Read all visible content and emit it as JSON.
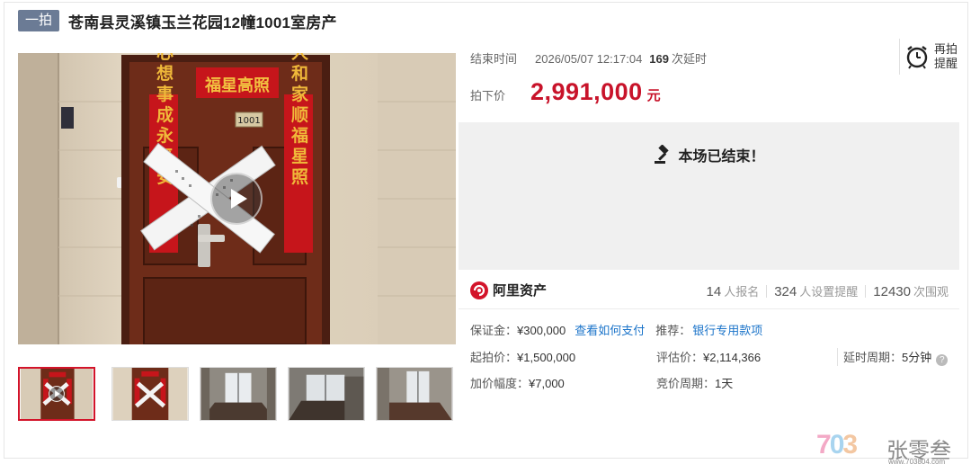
{
  "title": {
    "badge": "一拍",
    "text": "苍南县灵溪镇玉兰花园12幢1001室房产"
  },
  "photo": {
    "door_number": "1001",
    "top_banner": "福星高照",
    "left_couplet": "心想事成永平安",
    "right_couplet": "人和家顺福星照"
  },
  "auction": {
    "end_label": "结束时间",
    "end_datetime": "2026/05/07 12:17:04",
    "delay_count": "169",
    "delay_label": "次延时",
    "price_label": "拍下价",
    "price_value": "2,991,000",
    "price_unit": "元",
    "remind_line1": "再拍",
    "remind_line2": "提醒",
    "ended_text": "本场已结束！"
  },
  "platform": {
    "name": "阿里资产"
  },
  "stats": {
    "signups": "14",
    "signups_label": "人报名",
    "reminders": "324",
    "reminders_label": "人设置提醒",
    "views": "12430",
    "views_label": "次围观"
  },
  "details": {
    "deposit_label": "保证金：",
    "deposit_value": "¥300,000",
    "pay_link": "查看如何支付",
    "recommend_label": "推荐：",
    "recommend_link": "银行专用款项",
    "start_price_label": "起拍价：",
    "start_price_value": "¥1,500,000",
    "appraisal_label": "评估价：",
    "appraisal_value": "¥2,114,366",
    "delay_period_label": "延时周期：",
    "delay_period_value": "5分钟",
    "increment_label": "加价幅度：",
    "increment_value": "¥7,000",
    "bid_period_label": "竞价周期：",
    "bid_period_value": "1天"
  },
  "watermark": {
    "digits": "703",
    "name": "张零叁",
    "url": "www.703804.com"
  },
  "colors": {
    "price_red": "#c8132a",
    "badge": "#6b7b95",
    "link_blue": "#1a73c9",
    "ended_bg": "#f0f0f0"
  }
}
